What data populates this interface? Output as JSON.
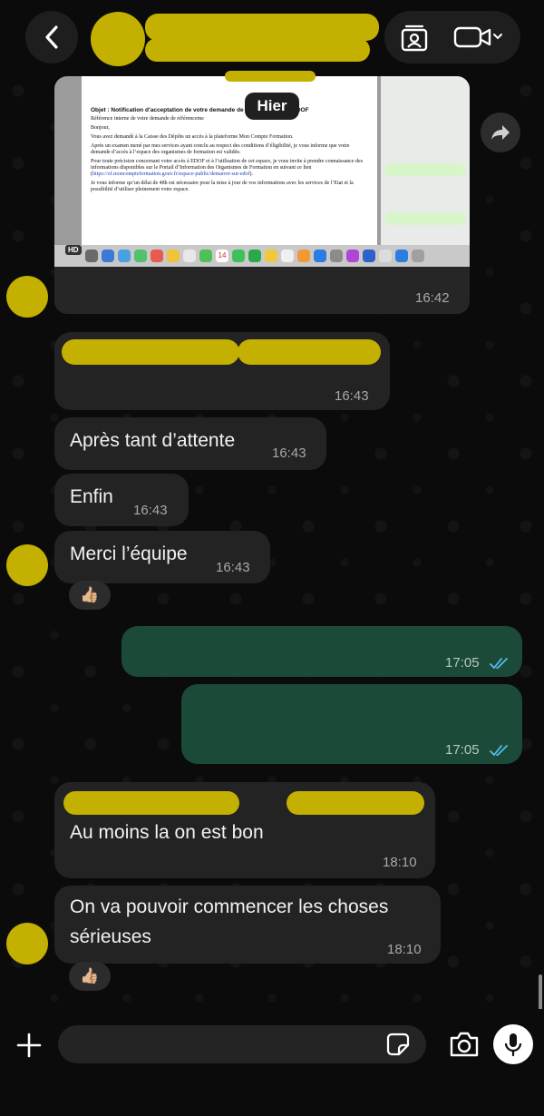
{
  "header": {
    "contact_name": "",
    "back_label": "Back",
    "contact_card_icon": "contact-card-icon",
    "video_icon": "video-camera-icon"
  },
  "date_separator": "Hier",
  "image_message": {
    "hd_badge": "HD",
    "document": {
      "header_fragment_left": "Pa",
      "header_fragment_right": "26",
      "subject": "Objet : Notification d’acceptation de votre demande de référencement à EDOF",
      "reference": "Référence interne de votre demande de référenceme",
      "greeting": "Bonjour,",
      "p1": "Vous avez demandé à la Caisse des Dépôts un accès à la plateforme Mon Compte Formation.",
      "p2": "Après un examen mené par mes services ayant conclu au respect des conditions d’éligibilité, je vous informe que votre demande d’accès à l’espace des organismes de formation est validée.",
      "p3": "Pour toute précision concernant votre accès à EDOF et à l’utilisation de cet espace, je vous invite à prendre connaissance des informations disponibles sur le Portail d’Information des Organismes de Formation en suivant ce lien (",
      "link": "https://of.moncompteformation.gouv.fr/espace-public/demarrer-sur-edof",
      "p3_end": ").",
      "p4": "Je vous informe qu’un délai de 48h est nécessaire pour la mise à jour de vos informations avec les services de l’Etat et la possibilité d’utiliser pleinement votre espace.",
      "dock_date": "14"
    },
    "time": "16:42"
  },
  "messages": [
    {
      "id": "m1",
      "text": "",
      "time": "16:43"
    },
    {
      "id": "m2",
      "text": "Après tant d’attente",
      "time": "16:43"
    },
    {
      "id": "m3",
      "text": "Enfin",
      "time": "16:43"
    },
    {
      "id": "m4",
      "text": "Merci l’équipe",
      "time": "16:43",
      "reaction": "👍🏼"
    },
    {
      "id": "m5",
      "text": "",
      "time": "17:05"
    },
    {
      "id": "m6",
      "text": "",
      "time": "17:05"
    },
    {
      "id": "m7",
      "text": "Au moins la on est bon",
      "time": "18:10"
    },
    {
      "id": "m8",
      "text_line1": "On va pouvoir commencer les choses",
      "text_line2": "sérieuses",
      "time": "18:10",
      "reaction": "👍🏼"
    }
  ],
  "composer": {
    "placeholder": "",
    "icons": [
      "plus-icon",
      "sticker-icon",
      "camera-icon",
      "microphone-icon"
    ]
  },
  "colors": {
    "background": "#0b0b0b",
    "incoming_bubble": "#232323",
    "outgoing_bubble": "#1b4a38",
    "redaction": "#c3b000",
    "read_ticks": "#53bdeb"
  }
}
